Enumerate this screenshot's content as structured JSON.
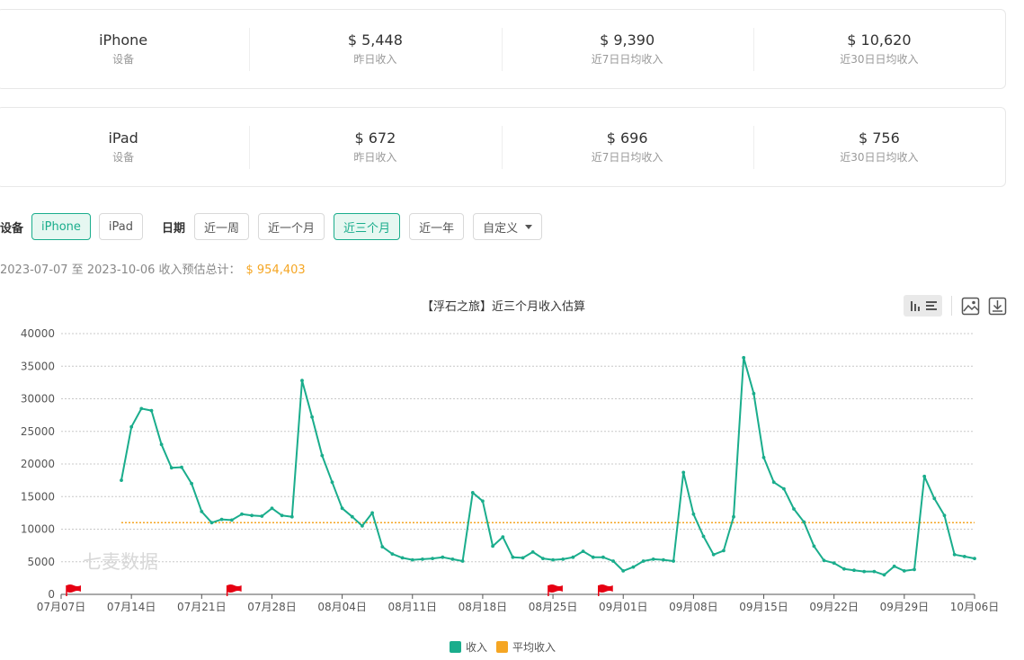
{
  "stats": [
    {
      "device": "iPhone",
      "device_label": "设备",
      "items": [
        {
          "value": "$ 5,448",
          "label": "昨日收入"
        },
        {
          "value": "$ 9,390",
          "label": "近7日日均收入"
        },
        {
          "value": "$ 10,620",
          "label": "近30日日均收入"
        }
      ]
    },
    {
      "device": "iPad",
      "device_label": "设备",
      "items": [
        {
          "value": "$ 672",
          "label": "昨日收入"
        },
        {
          "value": "$ 696",
          "label": "近7日日均收入"
        },
        {
          "value": "$ 756",
          "label": "近30日日均收入"
        }
      ]
    }
  ],
  "filters": {
    "device_label": "设备",
    "devices": [
      "iPhone",
      "iPad"
    ],
    "device_selected": "iPhone",
    "date_label": "日期",
    "ranges": [
      "近一周",
      "近一个月",
      "近三个月",
      "近一年"
    ],
    "range_selected": "近三个月",
    "custom_label": "自定义"
  },
  "summary": {
    "text": "2023-07-07 至 2023-10-06 收入预估总计：",
    "amount": "$ 954,403"
  },
  "watermark": "七麦数据",
  "colors": {
    "revenue": "#1aad8c",
    "average": "#f5a623",
    "flag": "#e60012"
  },
  "toolbar_icons": [
    "bar-chart-icon",
    "image-icon",
    "download-icon"
  ],
  "chart_data": {
    "type": "line",
    "title": "【浮石之旅】近三个月收入估算",
    "x_start": "2023-07-07",
    "x_end": "2023-10-06",
    "x_tick_labels": [
      "07月07日",
      "07月14日",
      "07月21日",
      "07月28日",
      "08月04日",
      "08月11日",
      "08月18日",
      "08月25日",
      "09月01日",
      "09月08日",
      "09月15日",
      "09月22日",
      "09月29日",
      "10月06日"
    ],
    "ylim": [
      0,
      40000
    ],
    "y_ticks": [
      0,
      5000,
      10000,
      15000,
      20000,
      25000,
      30000,
      35000,
      40000
    ],
    "grid": true,
    "legend_position": "bottom-center",
    "series": [
      {
        "name": "收入",
        "style": "line-with-points",
        "points": [
          [
            "07-13",
            17500
          ],
          [
            "07-14",
            25700
          ],
          [
            "07-15",
            28500
          ],
          [
            "07-16",
            28200
          ],
          [
            "07-17",
            23000
          ],
          [
            "07-18",
            19400
          ],
          [
            "07-19",
            19500
          ],
          [
            "07-20",
            17000
          ],
          [
            "07-21",
            12700
          ],
          [
            "07-22",
            11000
          ],
          [
            "07-23",
            11500
          ],
          [
            "07-24",
            11400
          ],
          [
            "07-25",
            12300
          ],
          [
            "07-26",
            12100
          ],
          [
            "07-27",
            12000
          ],
          [
            "07-28",
            13200
          ],
          [
            "07-29",
            12100
          ],
          [
            "07-30",
            11900
          ],
          [
            "07-31",
            32800
          ],
          [
            "08-01",
            27200
          ],
          [
            "08-02",
            21300
          ],
          [
            "08-03",
            17200
          ],
          [
            "08-04",
            13200
          ],
          [
            "08-05",
            11900
          ],
          [
            "08-06",
            10500
          ],
          [
            "08-07",
            12500
          ],
          [
            "08-08",
            7300
          ],
          [
            "08-09",
            6200
          ],
          [
            "08-10",
            5600
          ],
          [
            "08-11",
            5300
          ],
          [
            "08-12",
            5400
          ],
          [
            "08-13",
            5500
          ],
          [
            "08-14",
            5700
          ],
          [
            "08-15",
            5400
          ],
          [
            "08-16",
            5100
          ],
          [
            "08-17",
            15600
          ],
          [
            "08-18",
            14300
          ],
          [
            "08-19",
            7400
          ],
          [
            "08-20",
            8800
          ],
          [
            "08-21",
            5700
          ],
          [
            "08-22",
            5600
          ],
          [
            "08-23",
            6500
          ],
          [
            "08-24",
            5500
          ],
          [
            "08-25",
            5300
          ],
          [
            "08-26",
            5400
          ],
          [
            "08-27",
            5700
          ],
          [
            "08-28",
            6600
          ],
          [
            "08-29",
            5700
          ],
          [
            "08-30",
            5700
          ],
          [
            "08-31",
            5100
          ],
          [
            "09-01",
            3600
          ],
          [
            "09-02",
            4200
          ],
          [
            "09-03",
            5100
          ],
          [
            "09-04",
            5400
          ],
          [
            "09-05",
            5300
          ],
          [
            "09-06",
            5100
          ],
          [
            "09-07",
            18700
          ],
          [
            "09-08",
            12300
          ],
          [
            "09-09",
            8900
          ],
          [
            "09-10",
            6100
          ],
          [
            "09-11",
            6700
          ],
          [
            "09-12",
            11900
          ],
          [
            "09-13",
            36300
          ],
          [
            "09-14",
            30800
          ],
          [
            "09-15",
            21000
          ],
          [
            "09-16",
            17200
          ],
          [
            "09-17",
            16200
          ],
          [
            "09-18",
            13100
          ],
          [
            "09-19",
            11100
          ],
          [
            "09-20",
            7400
          ],
          [
            "09-21",
            5200
          ],
          [
            "09-22",
            4800
          ],
          [
            "09-23",
            3900
          ],
          [
            "09-24",
            3700
          ],
          [
            "09-25",
            3500
          ],
          [
            "09-26",
            3500
          ],
          [
            "09-27",
            3000
          ],
          [
            "09-28",
            4300
          ],
          [
            "09-29",
            3600
          ],
          [
            "09-30",
            3800
          ],
          [
            "10-01",
            18100
          ],
          [
            "10-02",
            14700
          ],
          [
            "10-03",
            12100
          ],
          [
            "10-04",
            6100
          ],
          [
            "10-05",
            5800
          ],
          [
            "10-06",
            5500
          ]
        ]
      },
      {
        "name": "平均收入",
        "style": "dotted",
        "value": 11000,
        "from": "07-13",
        "to": "10-06"
      }
    ],
    "flag_dates": [
      "07-07",
      "07-23",
      "08-24",
      "08-29"
    ]
  }
}
